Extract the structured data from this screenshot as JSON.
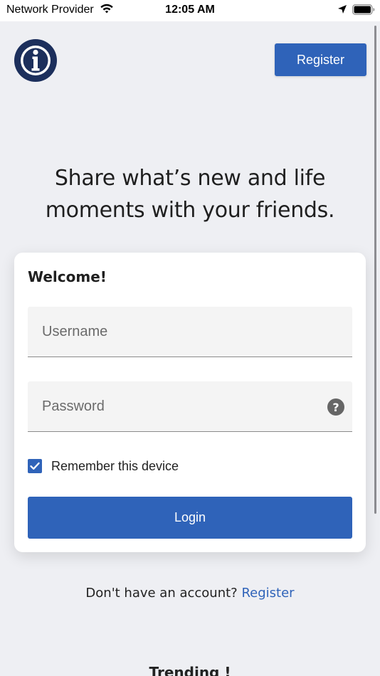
{
  "status_bar": {
    "carrier": "Network Provider",
    "time": "12:05 AM",
    "wifi_icon": "wifi-icon",
    "location_icon": "location-arrow-icon",
    "battery_icon": "battery-icon"
  },
  "header": {
    "logo_icon": "info-circle-logo",
    "register_label": "Register"
  },
  "hero": {
    "headline_line1": "Share what’s new and life",
    "headline_line2": "moments with your friends."
  },
  "login_card": {
    "title": "Welcome!",
    "username": {
      "placeholder": "Username",
      "value": ""
    },
    "password": {
      "placeholder": "Password",
      "value": "",
      "help_glyph": "?"
    },
    "remember": {
      "label": "Remember this device",
      "checked": true
    },
    "login_label": "Login"
  },
  "signup": {
    "prompt": "Don't have an account?",
    "link_label": "Register"
  },
  "trending": {
    "title": "Trending !"
  },
  "colors": {
    "accent": "#2f63b9",
    "background": "#eeeff3",
    "logo_dark": "#1c2f5c"
  }
}
